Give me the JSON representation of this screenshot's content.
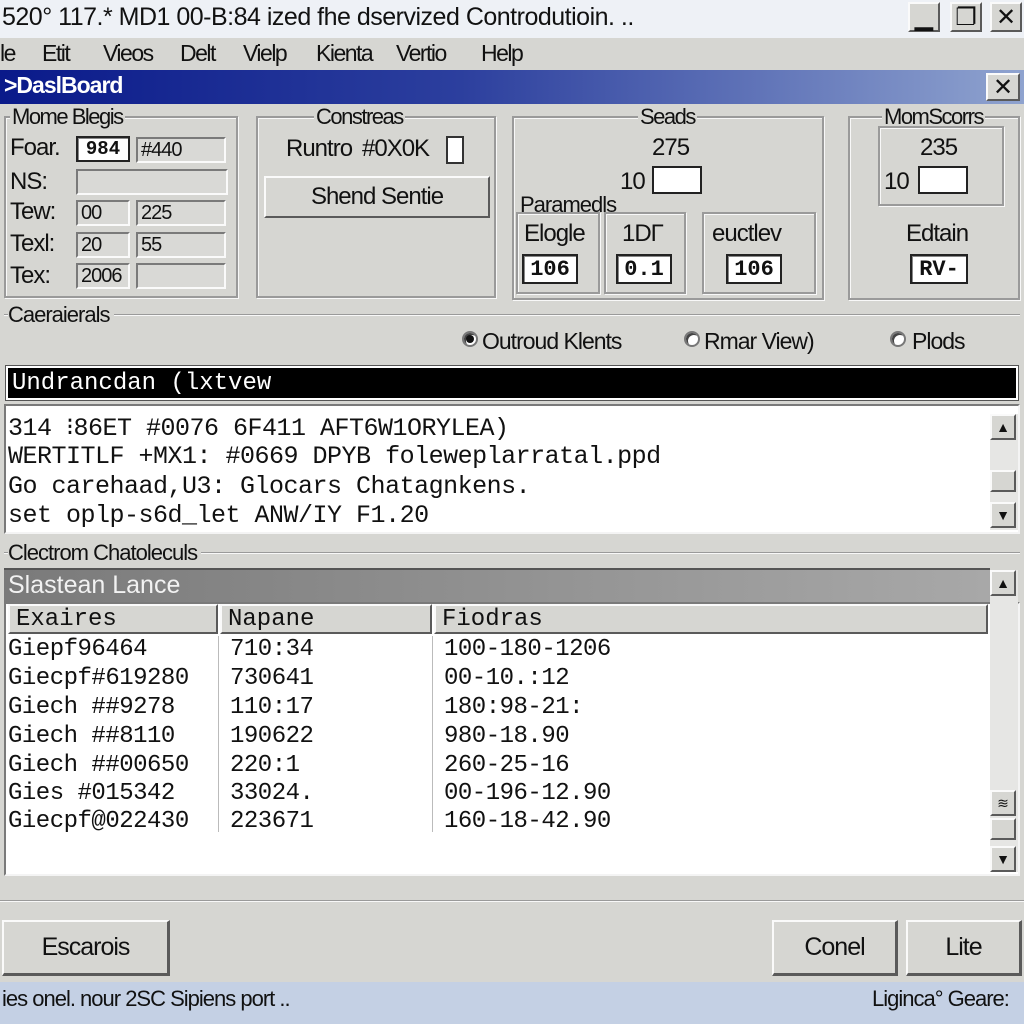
{
  "window": {
    "title": "520° 117.* MD1 00-B:84 ized fhe dservized Controdutioin. ..",
    "controls": [
      "▁",
      "❐",
      "✕"
    ]
  },
  "menu": [
    "le",
    "Etit",
    "Vieos",
    "Delt",
    "Vielp",
    "Kienta",
    "Vertio",
    "Help"
  ],
  "dashboard": {
    "title": ">DaslBoard",
    "close": "✕"
  },
  "groups": {
    "home": {
      "title": "Mome Blegis",
      "rows": [
        {
          "label": "Foar.",
          "v1": "984",
          "v2": "#440"
        },
        {
          "label": "NS:",
          "v1": "",
          "v2": ""
        },
        {
          "label": "Tew:",
          "v1": "00",
          "v2": "225"
        },
        {
          "label": "Texl:",
          "v1": "20",
          "v2": "55"
        },
        {
          "label": "Tex:",
          "v1": "2006",
          "v2": ""
        }
      ]
    },
    "constreas": {
      "title": "Constreas",
      "runtro_label": "Runtro",
      "runtro_value": "#0X0K",
      "button": "Shend Sentie"
    },
    "seads": {
      "title": "Seads",
      "value": "275",
      "field_label": "10",
      "params_title": "Paramedls",
      "params": [
        {
          "label": "Elogle",
          "value": "106"
        },
        {
          "label": "1DΓ",
          "value": "0.1"
        },
        {
          "label": "euctlev",
          "value": "106"
        }
      ]
    },
    "momscorrs": {
      "title": "MomScorrs",
      "value": "235",
      "field_label": "10",
      "edtain_label": "Edtain",
      "edtain_value": "RV-"
    }
  },
  "caeraierals": {
    "title": "Caeraierals",
    "radios": [
      {
        "label": "Outroud Klents",
        "selected": true
      },
      {
        "label": "Rmar View)",
        "selected": false
      },
      {
        "label": "Plods",
        "selected": false
      }
    ],
    "header": "Undrancdan (lxtvew",
    "lines": [
      "314 ⁝86ΕΤ #0076 6F411 AFT6W1ORYLEA)",
      "WERTITLF +MX1: #0669 DPYB foleweplarratal.ppd",
      "Go carehaad,U3: Glocars Chatagnkens.",
      "set oplp-s6d_let ANW/IY F1.20"
    ]
  },
  "electrom": {
    "title": "Clectrom Chatoleculs",
    "header": "Slastean Lance",
    "columns": [
      "Exaires",
      "Napane",
      "Fiodras"
    ],
    "rows": [
      [
        "Giepf96464",
        "710:34",
        "100-180-1206"
      ],
      [
        "Giecpf#619280",
        "730641",
        "00-10.:12"
      ],
      [
        "Giech ##9278",
        "110:17",
        "180:98-21:"
      ],
      [
        "Giech ##8110",
        "190622",
        "980-18.90"
      ],
      [
        "Giech ##00650",
        "220:1",
        "260-25-16"
      ],
      [
        "Gies #015342",
        "33024.",
        "00-196-12.90"
      ],
      [
        "Giecpf@022430",
        "223671",
        "160-18-42.90"
      ]
    ]
  },
  "buttons": {
    "left": "Escarois",
    "cancel": "Conel",
    "lite": "Lite"
  },
  "status": {
    "left": "ies onel. nour 2SC Sipiens port ..",
    "right": "Ligincа° Geare:"
  }
}
